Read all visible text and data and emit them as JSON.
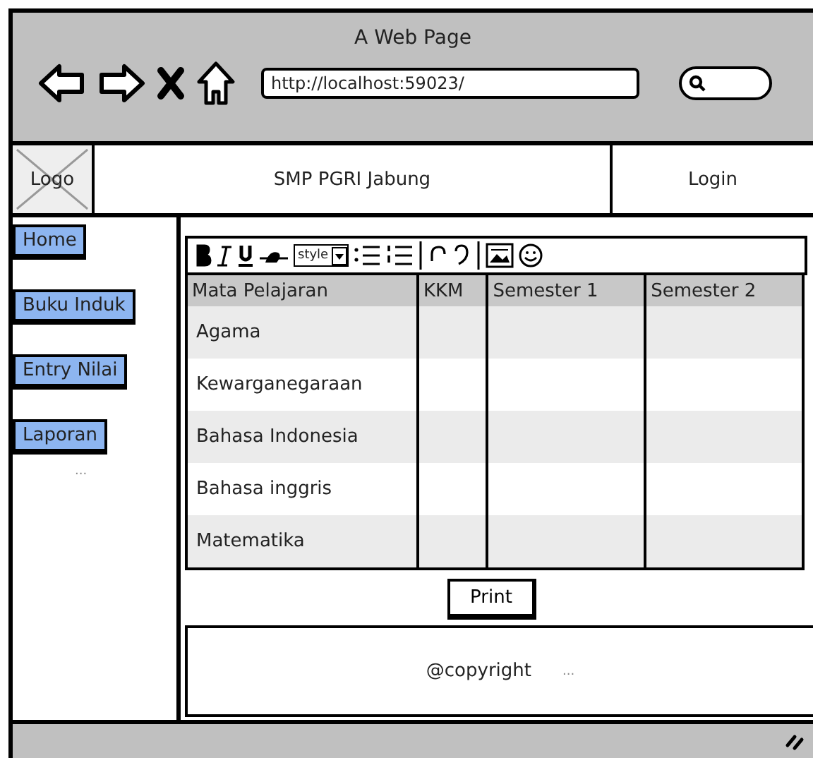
{
  "window": {
    "title": "A Web Page",
    "url": "http://localhost:59023/"
  },
  "header": {
    "logo": "Logo",
    "site_title": "SMP PGRI Jabung",
    "login": "Login"
  },
  "sidebar": {
    "items": [
      {
        "label": "Home"
      },
      {
        "label": "Buku Induk"
      },
      {
        "label": "Entry Nilai"
      },
      {
        "label": "Laporan"
      }
    ],
    "more": "..."
  },
  "toolbar": {
    "style_label": "style"
  },
  "table": {
    "columns": [
      "Mata Pelajaran",
      "KKM",
      "Semester 1",
      "Semester 2"
    ],
    "rows": [
      [
        "Agama",
        "",
        "",
        ""
      ],
      [
        "Kewarganegaraan",
        "",
        "",
        ""
      ],
      [
        "Bahasa Indonesia",
        "",
        "",
        ""
      ],
      [
        "Bahasa inggris",
        "",
        "",
        ""
      ],
      [
        "Matematika",
        "",
        "",
        ""
      ]
    ]
  },
  "print_button": "Print",
  "footer": {
    "text": "@copyright",
    "more": "..."
  }
}
